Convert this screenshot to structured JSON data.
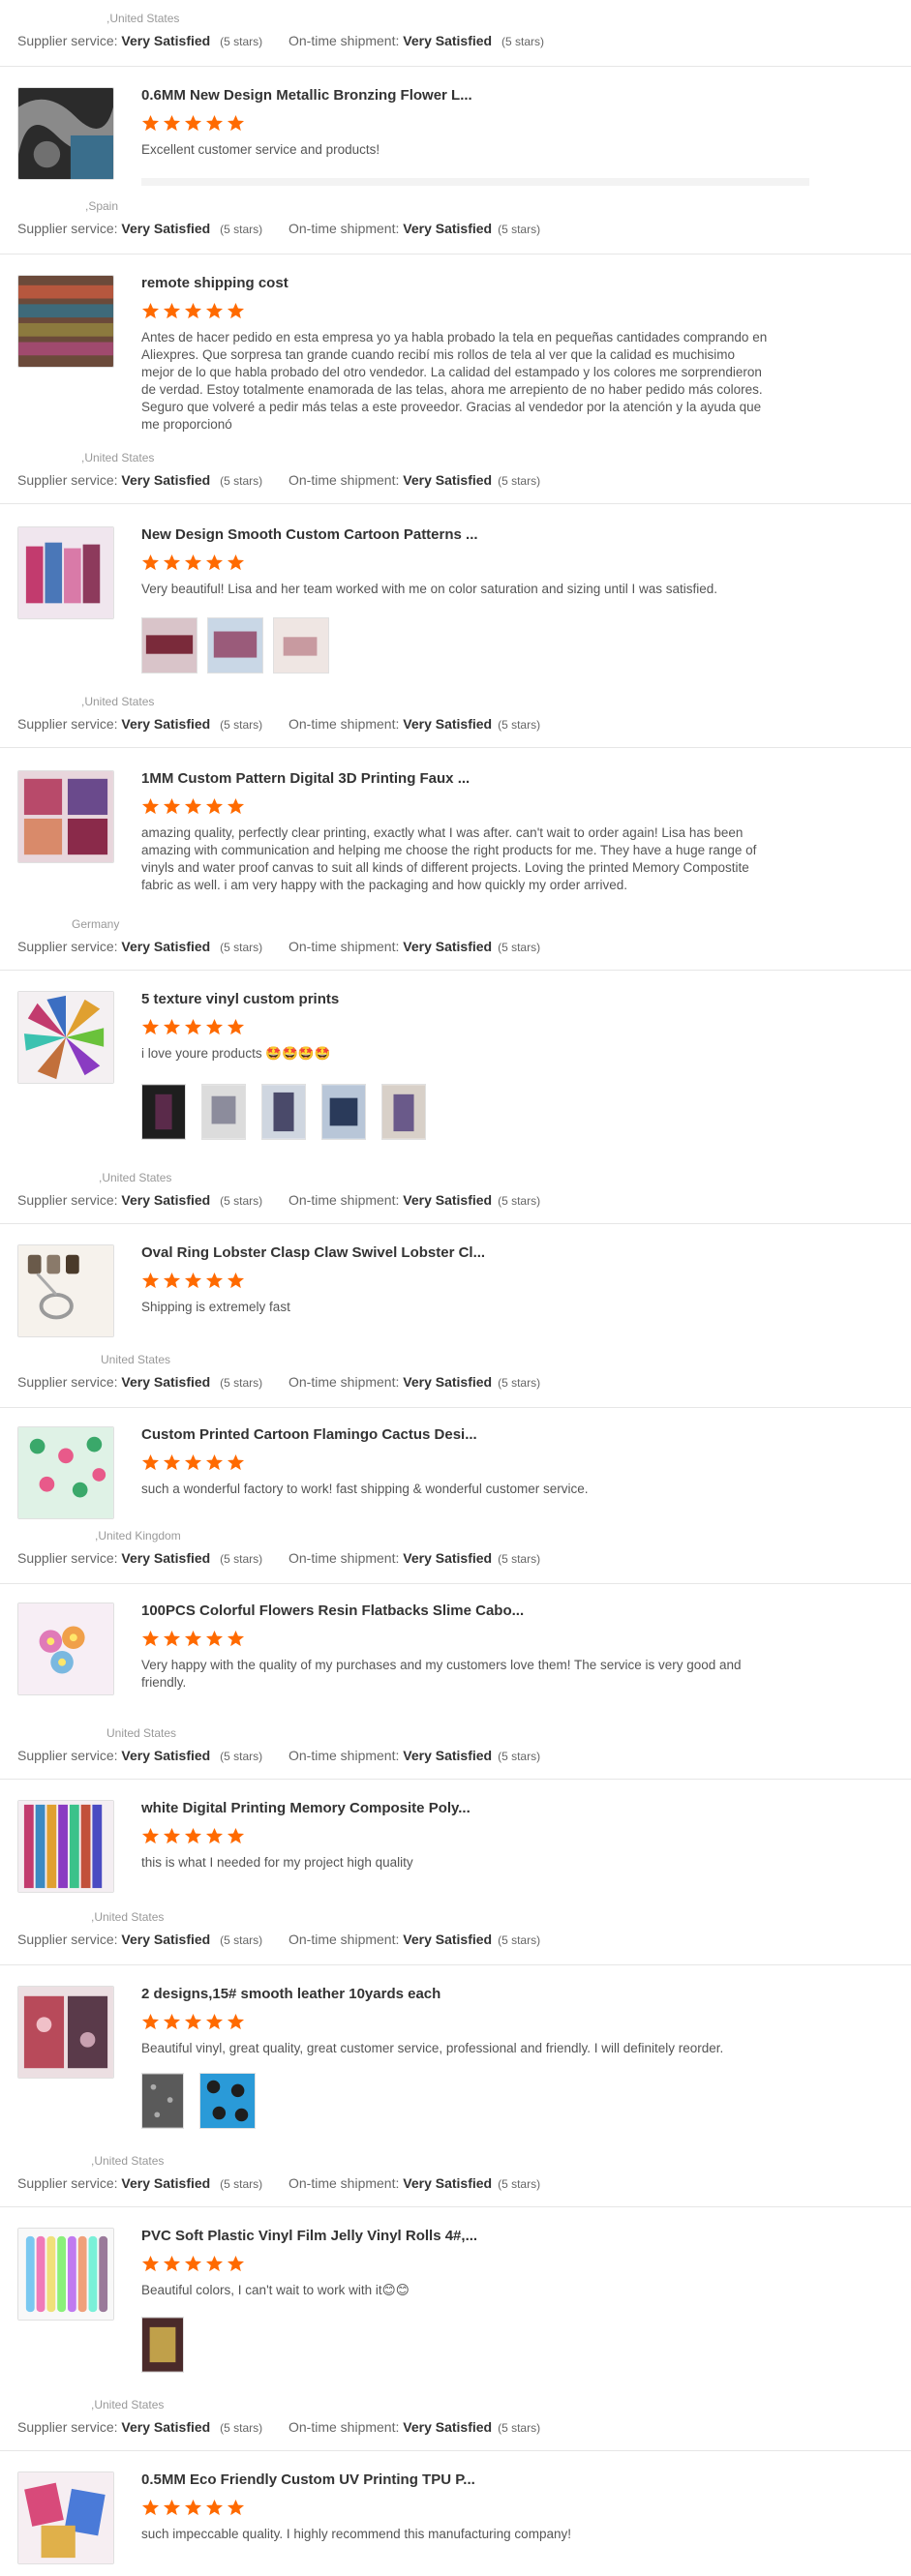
{
  "labels": {
    "supplier": "Supplier service:",
    "shipment": "On-time shipment:",
    "satisfied": "Very Satisfied",
    "stars_note": "(5 stars)"
  },
  "colors": {
    "star": "#ff6a00",
    "text": "#333333",
    "muted": "#999999"
  },
  "blocks": [
    {
      "country": ",United States"
    },
    {
      "country": ",Spain"
    },
    {
      "country": ",United States"
    },
    {
      "country": ",United States"
    },
    {
      "country": "Germany"
    },
    {
      "country": ",United States"
    },
    {
      "country": "United States"
    },
    {
      "country": ",United Kingdom"
    },
    {
      "country": "United States"
    },
    {
      "country": ",United States"
    },
    {
      "country": ",United States"
    },
    {
      "country": ",United States"
    }
  ],
  "reviews": [
    {
      "title": "0.6MM New Design Metallic Bronzing Flower L...",
      "text": "Excellent customer service and products!",
      "rating": 5
    },
    {
      "title": "remote shipping cost",
      "text": "Antes de hacer pedido en esta empresa yo ya habla probado la tela en pequeñas cantidades comprando en Aliexpres. Que sorpresa tan grande cuando recibí mis rollos de tela al ver que la calidad es muchisimo mejor de lo que habla probado del otro vendedor. La calidad del estampado y los colores me sorprendieron de verdad. Estoy totalmente enamorada de las telas, ahora me arrepiento de no haber pedido más colores. Seguro que volveré a pedir más telas a este proveedor. Gracias al vendedor por la atención y la ayuda que me proporcionó",
      "rating": 5
    },
    {
      "title": "New Design Smooth Custom Cartoon Patterns ...",
      "text": "Very beautiful! Lisa and her team worked with me on color saturation and sizing until I was satisfied.",
      "rating": 5
    },
    {
      "title": "1MM Custom Pattern Digital 3D Printing Faux ...",
      "text": "amazing quality, perfectly clear printing, exactly what I was after. can't wait to order again! Lisa has been amazing with communication and helping me choose the right products for me. They have a huge range of vinyls and water proof canvas to suit all kinds of different projects. Loving the printed Memory Compostite fabric as well. i am very happy with the packaging and how quickly my order arrived.",
      "rating": 5
    },
    {
      "title": "5 texture vinyl custom prints",
      "text": "i love youre products 🤩🤩🤩🤩",
      "rating": 5
    },
    {
      "title": "Oval Ring Lobster Clasp Claw Swivel Lobster Cl...",
      "text": "Shipping is extremely fast",
      "rating": 5
    },
    {
      "title": "Custom Printed Cartoon Flamingo Cactus Desi...",
      "text": "such a wonderful factory to work! fast shipping & wonderful customer service.",
      "rating": 5
    },
    {
      "title": "100PCS Colorful Flowers Resin Flatbacks Slime Cabo...",
      "text": "Very happy with the quality of my purchases and my customers love them! The service is very good and friendly.",
      "rating": 5
    },
    {
      "title": "white Digital Printing Memory Composite Poly...",
      "text": "this is what I needed for my project high quality",
      "rating": 5
    },
    {
      "title": "2 designs,15# smooth leather 10yards each",
      "text": "Beautiful vinyl, great quality, great customer service, professional and friendly. I will definitely reorder.",
      "rating": 5
    },
    {
      "title": "PVC Soft Plastic Vinyl Film Jelly Vinyl Rolls 4#,...",
      "text": "Beautiful colors, I can't wait to work with it😊😊",
      "rating": 5
    },
    {
      "title": "0.5MM Eco Friendly Custom UV Printing TPU P...",
      "text": "such impeccable quality. I highly recommend this manufacturing company!",
      "rating": 5
    }
  ]
}
